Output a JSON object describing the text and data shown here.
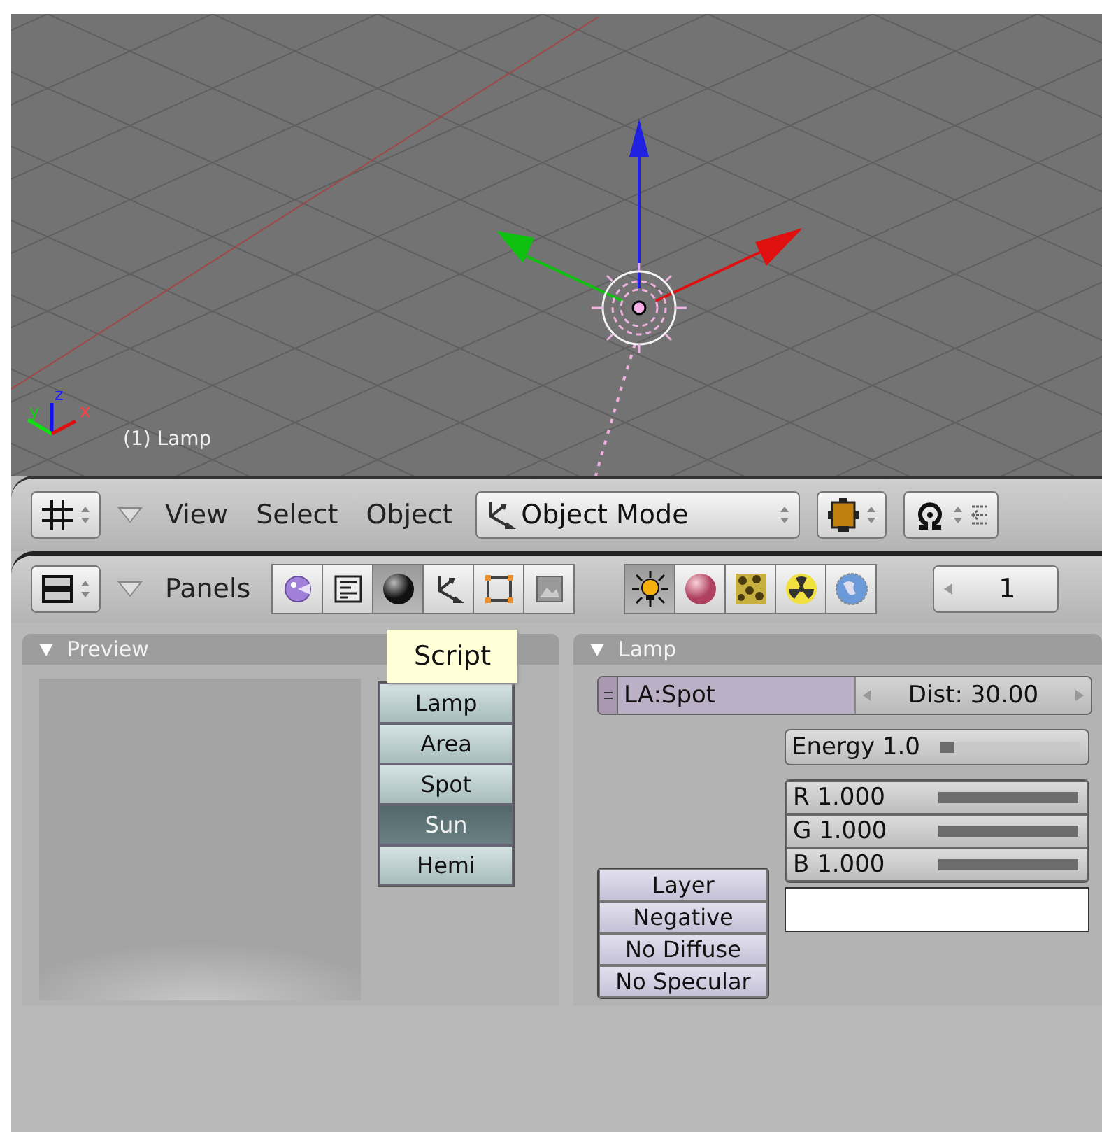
{
  "viewport": {
    "object_label": "(1) Lamp",
    "axis_labels": [
      "z",
      "y",
      "x"
    ]
  },
  "header": {
    "menus": [
      "View",
      "Select",
      "Object"
    ],
    "mode": "Object Mode"
  },
  "buttons_header": {
    "label": "Panels",
    "context_tabs": [
      {
        "kind": "logic",
        "selected": false
      },
      {
        "kind": "script",
        "selected": false
      },
      {
        "kind": "shading",
        "selected": true
      },
      {
        "kind": "object",
        "selected": false
      },
      {
        "kind": "editing",
        "selected": false
      },
      {
        "kind": "scene",
        "selected": false
      }
    ],
    "sub_tabs": [
      {
        "kind": "lamp",
        "selected": true
      },
      {
        "kind": "material",
        "selected": false
      },
      {
        "kind": "texture",
        "selected": false
      },
      {
        "kind": "radiosity",
        "selected": false
      },
      {
        "kind": "world",
        "selected": false
      }
    ],
    "frame": "1"
  },
  "preview": {
    "title": "Preview",
    "tooltip": "Script",
    "lamp_types": [
      {
        "label": "Lamp",
        "selected": false
      },
      {
        "label": "Area",
        "selected": false
      },
      {
        "label": "Spot",
        "selected": false
      },
      {
        "label": "Sun",
        "selected": true
      },
      {
        "label": "Hemi",
        "selected": false
      }
    ]
  },
  "lamp": {
    "title": "Lamp",
    "name": "LA:Spot",
    "dist": "Dist: 30.00",
    "energy": {
      "reading": "Energy 1.0",
      "level": 0.1
    },
    "colors": [
      {
        "reading": "R 1.000",
        "level": 1
      },
      {
        "reading": "G 1.000",
        "level": 1
      },
      {
        "reading": "B 1.000",
        "level": 1
      }
    ],
    "toggles": [
      {
        "label": "Layer",
        "on": false
      },
      {
        "label": "Negative",
        "on": false
      },
      {
        "label": "No Diffuse",
        "on": false
      },
      {
        "label": "No Specular",
        "on": false
      }
    ]
  }
}
